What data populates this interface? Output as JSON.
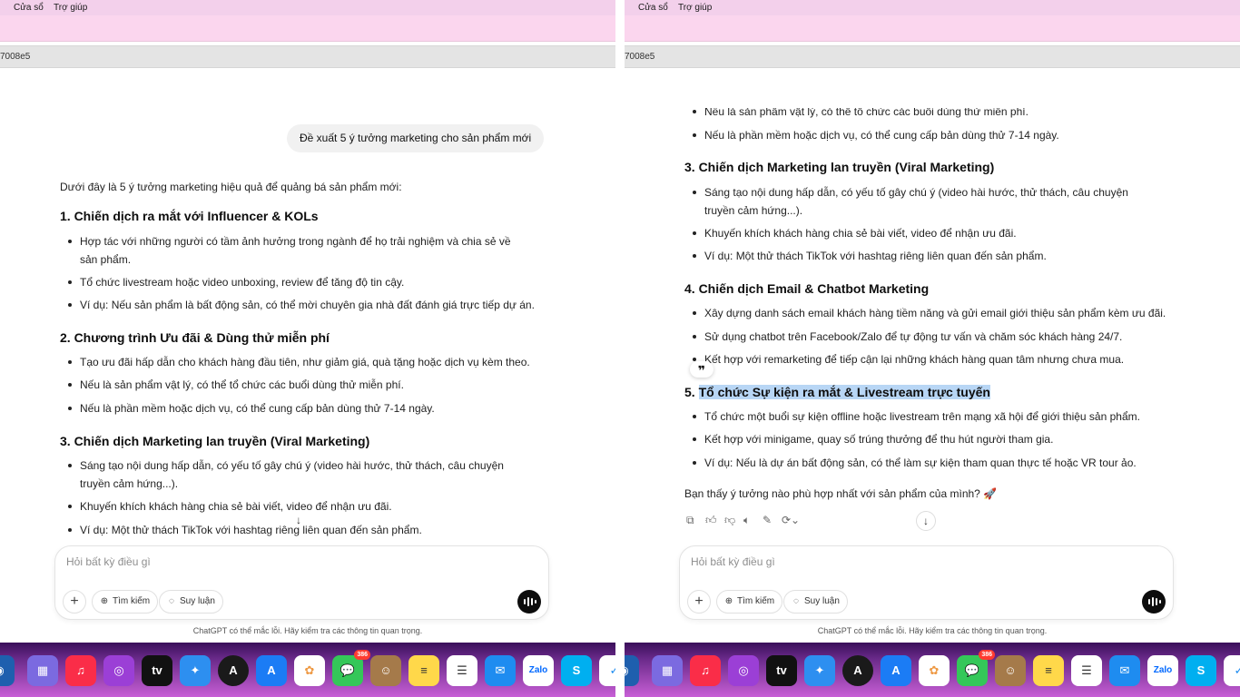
{
  "menu": {
    "window": "Cửa sổ",
    "help": "Trợ giúp"
  },
  "url_fragment": "7008e5",
  "user_message": "Đề xuất 5 ý tưởng marketing cho sản phẩm mới",
  "intro": "Dưới đây là 5 ý tưởng marketing hiệu quả để quảng bá sản phẩm mới:",
  "sections": [
    {
      "title": "1. Chiến dịch ra mắt với Influencer & KOLs",
      "items": [
        "Hợp tác với những người có tầm ảnh hưởng trong ngành để họ trải nghiệm và chia sẻ về sản phẩm.",
        "Tổ chức livestream hoặc video unboxing, review để tăng độ tin cậy.",
        "Ví dụ: Nếu sản phẩm là bất động sản, có thể mời chuyên gia nhà đất đánh giá trực tiếp dự án."
      ]
    },
    {
      "title": "2. Chương trình Ưu đãi & Dùng thử miễn phí",
      "items": [
        "Tạo ưu đãi hấp dẫn cho khách hàng đầu tiên, như giảm giá, quà tặng hoặc dịch vụ kèm theo.",
        "Nếu là sản phẩm vật lý, có thể tổ chức các buổi dùng thử miễn phí.",
        "Nếu là phần mềm hoặc dịch vụ, có thể cung cấp bản dùng thử 7-14 ngày."
      ]
    },
    {
      "title": "3. Chiến dịch Marketing lan truyền (Viral Marketing)",
      "items": [
        "Sáng tạo nội dung hấp dẫn, có yếu tố gây chú ý (video hài hước, thử thách, câu chuyện truyền cảm hứng...).",
        "Khuyến khích khách hàng chia sẻ bài viết, video để nhận ưu đãi.",
        "Ví dụ: Một thử thách TikTok với hashtag riêng liên quan đến sản phẩm."
      ]
    },
    {
      "title": "4. Chiến dịch Email & Chatbot Marketing",
      "items": [
        "Xây dựng danh sách email khách hàng tiềm năng và gửi email giới thiệu sản phẩm kèm ưu đãi.",
        "Sử dụng chatbot trên Facebook/Zalo để tự động tư vấn và chăm sóc khách hàng 24/7.",
        "Kết hợp với remarketing để tiếp cận lại những khách hàng quan tâm nhưng chưa mua."
      ]
    },
    {
      "title_prefix": "5. ",
      "title": "Tổ chức Sự kiện ra mắt & Livestream trực tuyến",
      "items": [
        "Tổ chức một buổi sự kiện offline hoặc livestream trên mạng xã hội để giới thiệu sản phẩm.",
        "Kết hợp với minigame, quay số trúng thưởng để thu hút người tham gia.",
        "Ví dụ: Nếu là dự án bất động sản, có thể làm sự kiện tham quan thực tế hoặc VR tour ảo."
      ]
    }
  ],
  "closing": "Bạn thấy ý tưởng nào phù hợp nhất với sản phẩm của mình? 🚀",
  "input": {
    "placeholder": "Hỏi bất kỳ điều gì",
    "search": "Tìm kiếm",
    "reason": "Suy luận"
  },
  "disclaimer": "ChatGPT có thể mắc lỗi. Hãy kiểm tra các thông tin quan trọng.",
  "dock": {
    "messages_badge": "386",
    "zalo": "Zalo"
  },
  "icons": {
    "plus": "plus-icon",
    "globe": "globe-icon",
    "bulb": "lightbulb-icon",
    "voice": "voice-icon",
    "arrow": "arrow-down-icon"
  }
}
